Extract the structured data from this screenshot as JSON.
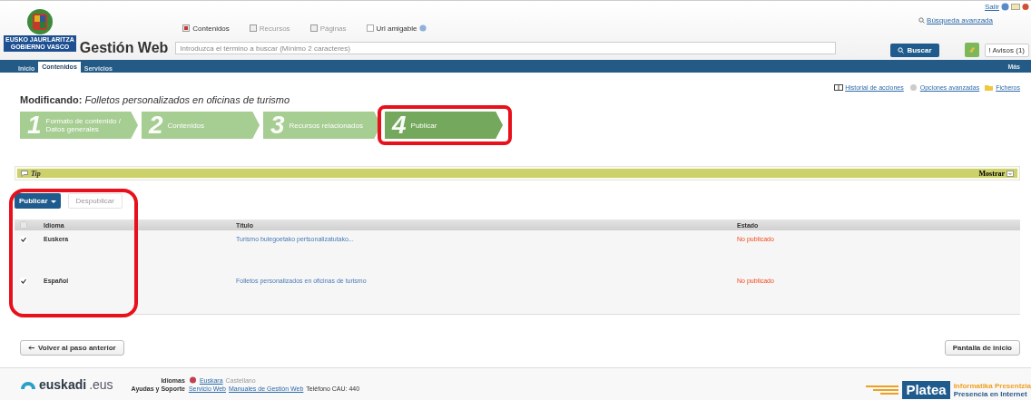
{
  "header": {
    "logo_lines": [
      "EUSKO JAURLARITZA",
      "GOBIERNO VASCO"
    ],
    "app_title": "Gestión Web",
    "scope_options": [
      {
        "label": "Contenidos",
        "selected": true
      },
      {
        "label": "Recursos",
        "selected": false
      },
      {
        "label": "Páginas",
        "selected": false
      }
    ],
    "friendly_url": {
      "label": "Url amigable",
      "checked": false
    },
    "search": {
      "placeholder": "Introduzca el término a buscar (Mínimo 2 caracteres)"
    },
    "advanced_search": "Búsqueda avanzada",
    "search_button": "Buscar",
    "user_link": "Salir",
    "notices_button": "! Avisos (1)"
  },
  "nav": {
    "tabs": [
      {
        "label": "Inicio",
        "selected": false
      },
      {
        "label": "Contenidos",
        "selected": true
      },
      {
        "label": "Servicios",
        "selected": false
      }
    ],
    "more": "Más"
  },
  "page_links": [
    "Historial de acciones",
    "Opciones avanzadas",
    "Ficheros"
  ],
  "heading": {
    "prefix": "Modificando:",
    "title": "Folletos personalizados en oficinas de turismo"
  },
  "steps": [
    {
      "number": "1",
      "label": "Formato de contenido / Datos generales",
      "selected": false,
      "highlighted": false
    },
    {
      "number": "2",
      "label": "Contenidos",
      "selected": false,
      "highlighted": false
    },
    {
      "number": "3",
      "label": "Recursos relacionados",
      "selected": false,
      "highlighted": false
    },
    {
      "number": "4",
      "label": "Publicar",
      "selected": true,
      "highlighted": true
    }
  ],
  "tip": {
    "label": "Tip",
    "toggle": "Mostrar"
  },
  "toolbar": {
    "publish_button": "Publicar",
    "secondary_button": {
      "label": "Despublicar",
      "disabled": true
    }
  },
  "table": {
    "columns": [
      "Idioma",
      "Título",
      "Estado"
    ],
    "all_checked": false,
    "highlighted": true,
    "rows": [
      {
        "language": "Euskera",
        "title": "Turismo bulegoetako pertsonalizatutako...",
        "status": "No publicado",
        "checked": true
      },
      {
        "language": "Español",
        "title": "Folletos personalizados en oficinas de turismo",
        "status": "No publicado",
        "checked": true
      }
    ]
  },
  "buttons": {
    "back": "Volver al paso anterior",
    "home": "Pantalla de inicio"
  },
  "footer": {
    "brand": "euskadi",
    "brand_suffix": ".eus",
    "languages_label": "Idiomas",
    "languages": [
      "Euskara",
      "Castellano"
    ],
    "support_label": "Ayudas y Soporte",
    "support_links": [
      "Servicio Web",
      "Manuales de Gestión Web"
    ],
    "phone": "Teléfono CAU: 440",
    "platea": "Platea",
    "platea_lines": [
      "Informatika Presentzia",
      "Presencia en Internet"
    ]
  }
}
